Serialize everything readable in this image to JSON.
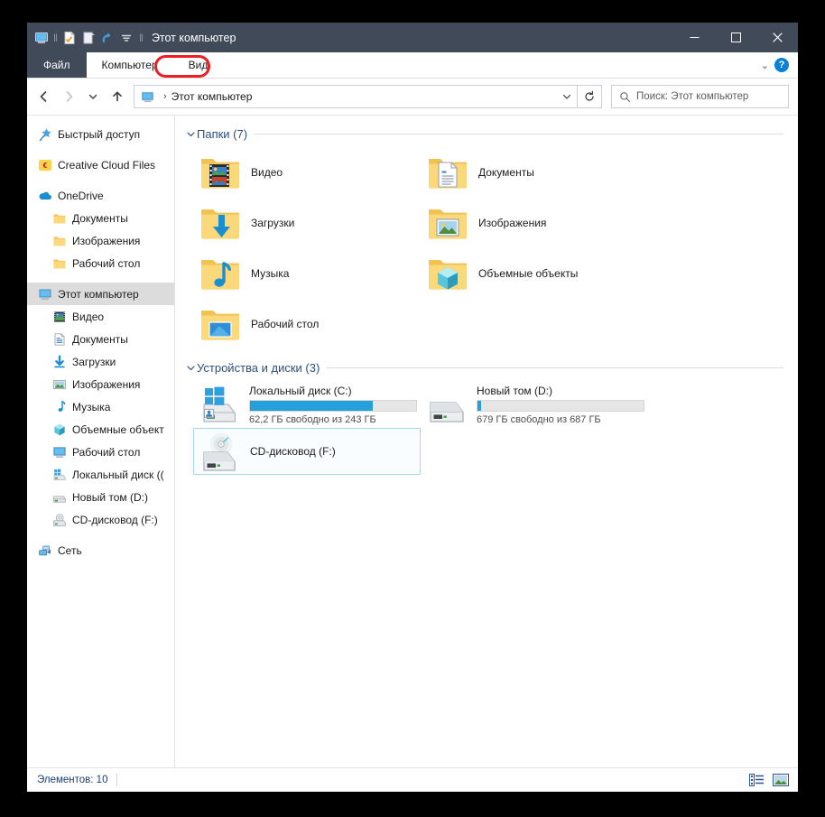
{
  "window": {
    "title": "Этот компьютер",
    "quick_access": [
      {
        "name": "this-pc-icon",
        "label": "Этот компьютер"
      },
      {
        "name": "properties-icon",
        "label": "Свойства"
      },
      {
        "name": "new-folder-icon",
        "label": "Новая папка"
      },
      {
        "name": "redo-icon",
        "label": "Вернуть"
      },
      {
        "name": "customize-qat-chevron-icon",
        "label": "Настроить панель быстрого доступа"
      }
    ],
    "controls": {
      "minimize": "—",
      "maximize": "□",
      "close": "✕"
    }
  },
  "ribbon": {
    "tabs": [
      {
        "label": "Файл",
        "active": false,
        "style": "file"
      },
      {
        "label": "Компьютер",
        "active": false,
        "style": "normal"
      },
      {
        "label": "Вид",
        "active": false,
        "style": "normal",
        "highlighted": true
      }
    ],
    "collapse_chevron": "⌄",
    "help_label": "?"
  },
  "address": {
    "back_label": "Назад",
    "forward_label": "Вперед",
    "recent_label": "Последние расположения",
    "up_label": "Вверх",
    "breadcrumb_icon": "this-pc-icon",
    "breadcrumb_separator": "›",
    "breadcrumb_text": "Этот компьютер",
    "dropdown_label": "⌄",
    "refresh_label": "↻"
  },
  "search": {
    "placeholder": "Поиск: Этот компьютер",
    "icon": "search-icon"
  },
  "sidebar": {
    "items": [
      {
        "label": "Быстрый доступ",
        "icon": "pin-star-icon",
        "level": 0,
        "selected": false,
        "gap_before": false
      },
      {
        "label": "Creative Cloud Files",
        "icon": "creative-cloud-icon",
        "level": 0,
        "selected": false,
        "gap_before": true
      },
      {
        "label": "OneDrive",
        "icon": "onedrive-cloud-icon",
        "level": 0,
        "selected": false,
        "gap_before": true
      },
      {
        "label": "Документы",
        "icon": "folder-icon",
        "level": 1,
        "selected": false,
        "gap_before": false
      },
      {
        "label": "Изображения",
        "icon": "folder-icon",
        "level": 1,
        "selected": false,
        "gap_before": false
      },
      {
        "label": "Рабочий стол",
        "icon": "folder-icon",
        "level": 1,
        "selected": false,
        "gap_before": false
      },
      {
        "label": "Этот компьютер",
        "icon": "this-pc-icon",
        "level": 0,
        "selected": true,
        "gap_before": true
      },
      {
        "label": "Видео",
        "icon": "videos-folder-icon",
        "level": 1,
        "selected": false,
        "gap_before": false
      },
      {
        "label": "Документы",
        "icon": "documents-folder-icon",
        "level": 1,
        "selected": false,
        "gap_before": false
      },
      {
        "label": "Загрузки",
        "icon": "downloads-icon",
        "level": 1,
        "selected": false,
        "gap_before": false
      },
      {
        "label": "Изображения",
        "icon": "pictures-folder-icon",
        "level": 1,
        "selected": false,
        "gap_before": false
      },
      {
        "label": "Музыка",
        "icon": "music-note-icon",
        "level": 1,
        "selected": false,
        "gap_before": false
      },
      {
        "label": "Объемные объект",
        "icon": "3d-objects-icon",
        "level": 1,
        "selected": false,
        "gap_before": false
      },
      {
        "label": "Рабочий стол",
        "icon": "desktop-icon",
        "level": 1,
        "selected": false,
        "gap_before": false
      },
      {
        "label": "Локальный диск ((",
        "icon": "system-drive-icon",
        "level": 1,
        "selected": false,
        "gap_before": false
      },
      {
        "label": "Новый том (D:)",
        "icon": "drive-icon",
        "level": 1,
        "selected": false,
        "gap_before": false
      },
      {
        "label": "CD-дисковод (F:)",
        "icon": "cd-drive-icon",
        "level": 1,
        "selected": false,
        "gap_before": false
      },
      {
        "label": "Сеть",
        "icon": "network-icon",
        "level": 0,
        "selected": false,
        "gap_before": true
      }
    ]
  },
  "content": {
    "groups": [
      {
        "title": "Папки (7)",
        "chevron": "⌄",
        "items": [
          {
            "label": "Видео",
            "icon": "videos-folder-icon"
          },
          {
            "label": "Документы",
            "icon": "documents-folder-icon"
          },
          {
            "label": "Загрузки",
            "icon": "downloads-folder-icon"
          },
          {
            "label": "Изображения",
            "icon": "pictures-folder-icon"
          },
          {
            "label": "Музыка",
            "icon": "music-folder-icon"
          },
          {
            "label": "Объемные объекты",
            "icon": "3d-objects-folder-icon"
          },
          {
            "label": "Рабочий стол",
            "icon": "desktop-folder-icon"
          }
        ]
      }
    ],
    "drives_group": {
      "title": "Устройства и диски (3)",
      "chevron": "⌄",
      "drives": [
        {
          "label": "Локальный диск (C:)",
          "icon": "system-drive-icon",
          "has_bar": true,
          "used_percent": 74,
          "free_text": "62,2 ГБ свободно из 243 ГБ",
          "selected": false
        },
        {
          "label": "Новый том (D:)",
          "icon": "drive-icon",
          "has_bar": true,
          "used_percent": 2,
          "free_text": "679 ГБ свободно из 687 ГБ",
          "selected": false
        },
        {
          "label": "CD-дисковод (F:)",
          "icon": "cd-drive-icon",
          "has_bar": false,
          "used_percent": 0,
          "free_text": "",
          "selected": true
        }
      ]
    }
  },
  "statusbar": {
    "items_text": "Элементов: 10",
    "views": [
      {
        "name": "details-view-button",
        "label": "Таблица"
      },
      {
        "name": "large-icons-view-button",
        "label": "Крупные значки"
      }
    ]
  },
  "colors": {
    "titlebar": "#414A59",
    "accent_blue": "#26a0da",
    "group_title": "#2c4f7c",
    "annotation_red": "#ee1c23",
    "selection_bg": "#dcdcdc"
  }
}
